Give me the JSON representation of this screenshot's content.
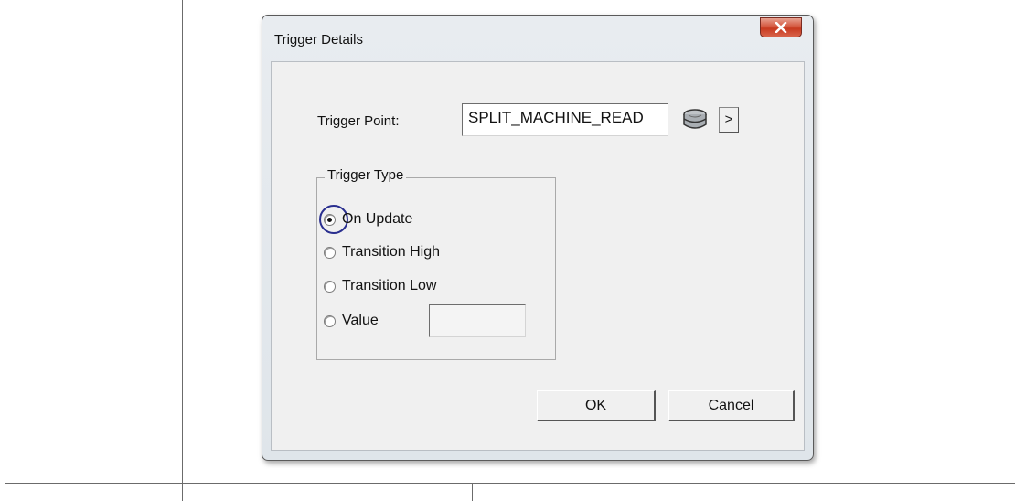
{
  "dialog": {
    "title": "Trigger Details",
    "trigger_point_label": "Trigger Point:",
    "trigger_point_value": "SPLIT_MACHINE_READ",
    "arrow_label": ">",
    "trigger_type": {
      "legend": "Trigger Type",
      "options": [
        {
          "label": "On Update",
          "checked": true
        },
        {
          "label": "Transition High",
          "checked": false
        },
        {
          "label": "Transition Low",
          "checked": false
        },
        {
          "label": "Value",
          "checked": false
        }
      ],
      "value_field": ""
    },
    "ok_label": "OK",
    "cancel_label": "Cancel"
  },
  "icons": {
    "close": "close-icon",
    "browse": "database-browse-icon"
  },
  "colors": {
    "close_button": "#c7391f",
    "focus_ring": "#2a2f8f"
  }
}
